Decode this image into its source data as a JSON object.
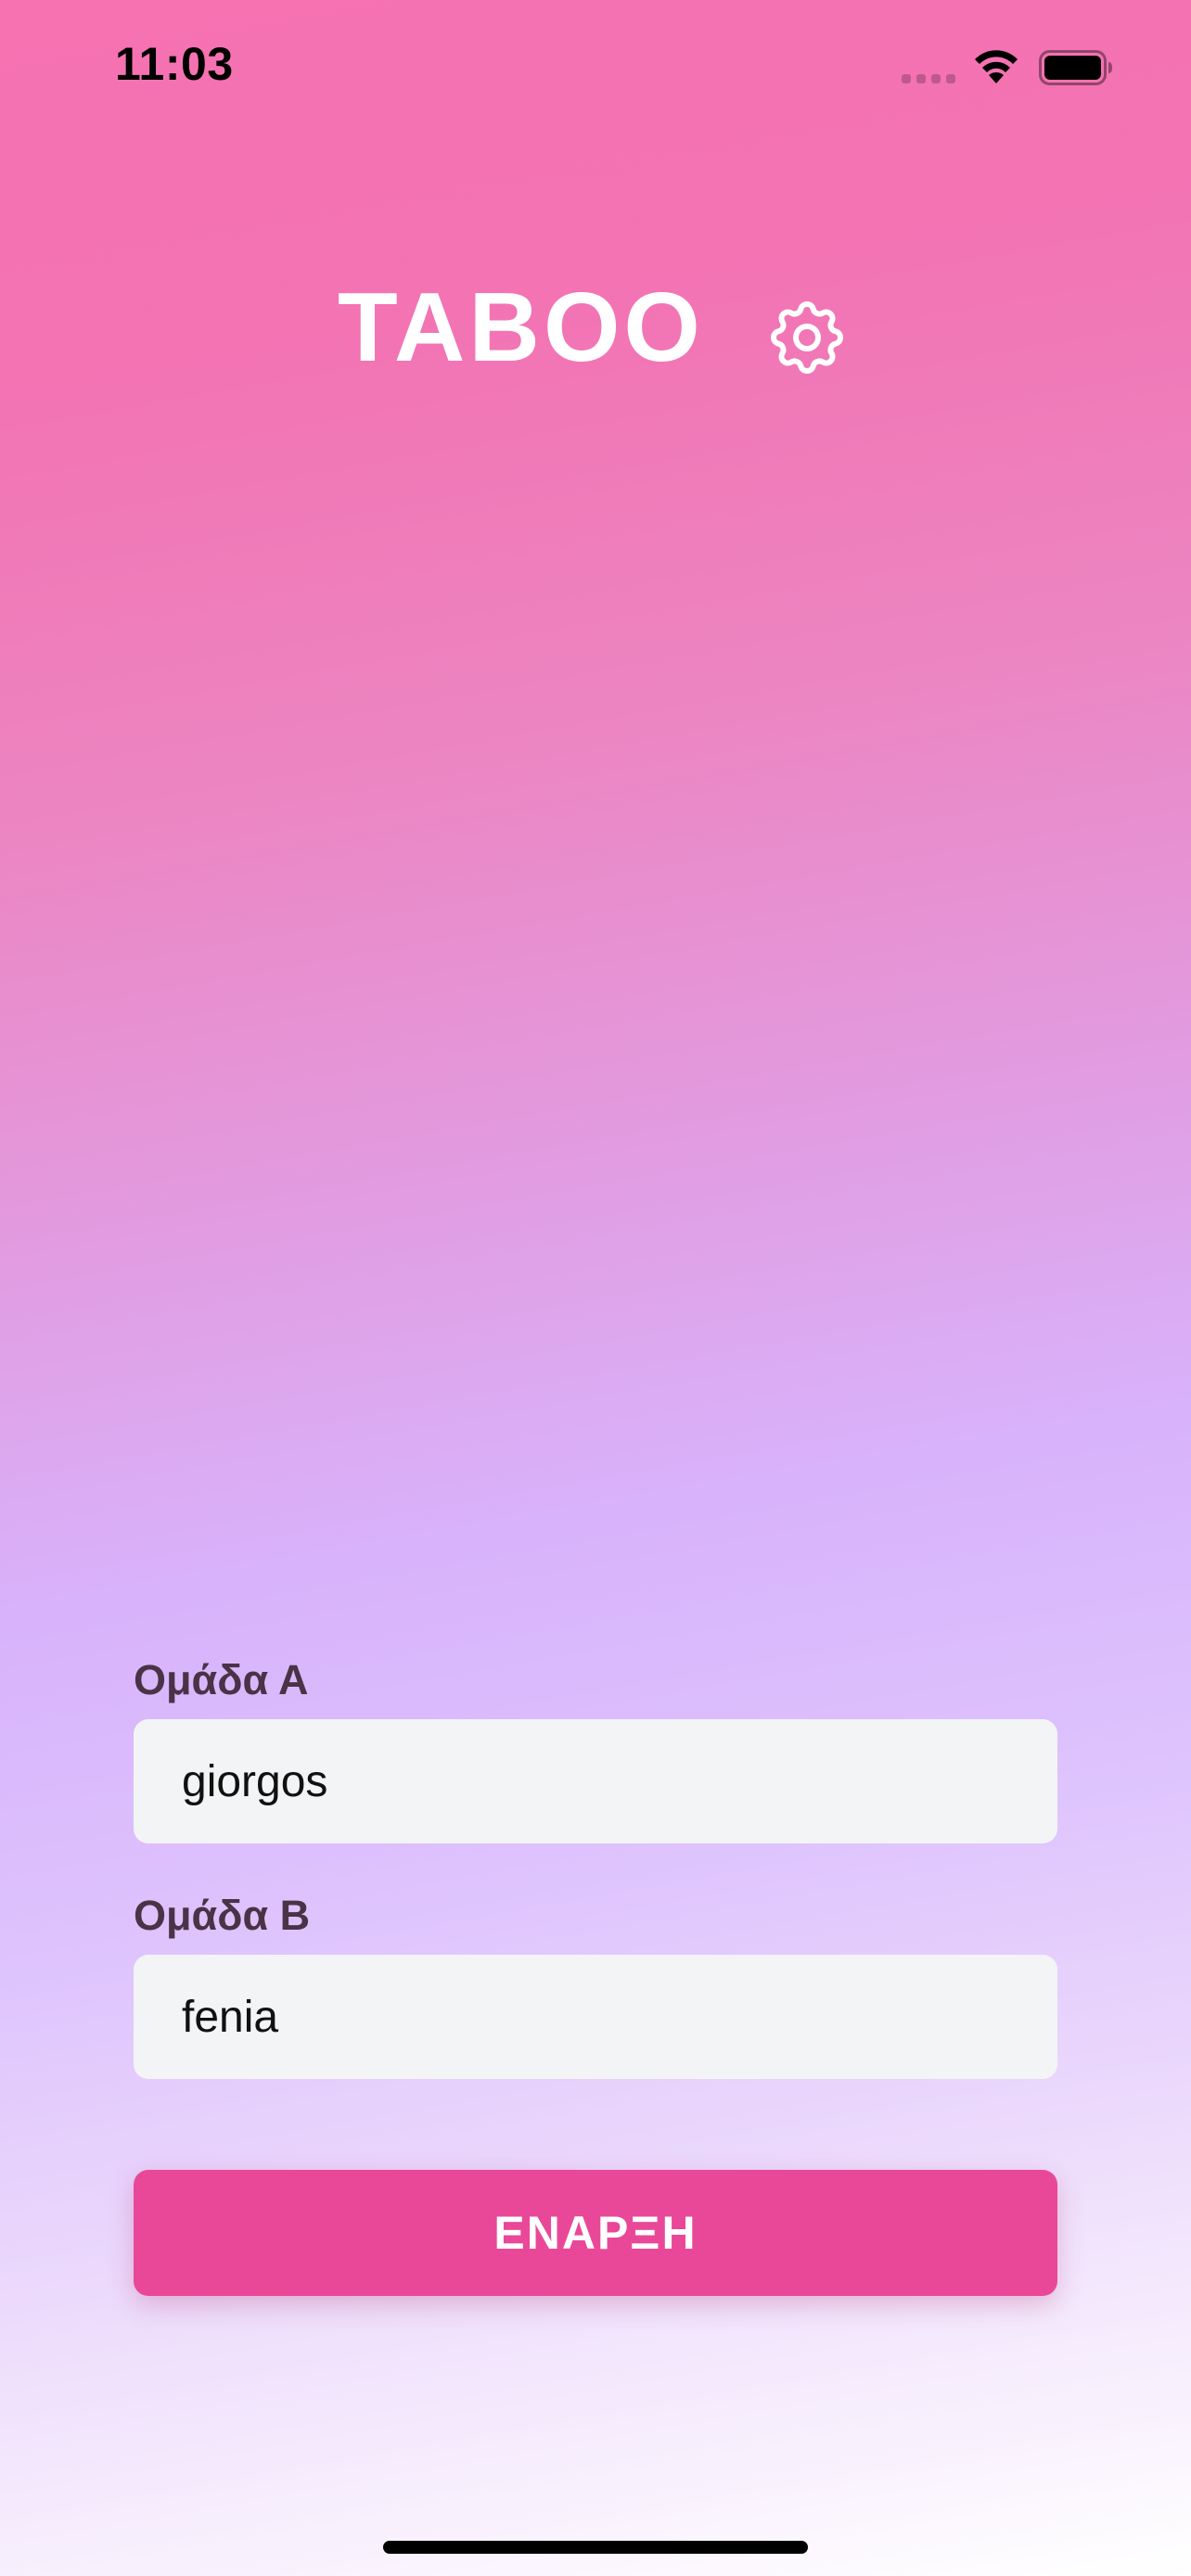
{
  "status_bar": {
    "time": "11:03",
    "icons": [
      "cellular-signal-icon",
      "wifi-icon",
      "battery-icon"
    ]
  },
  "header": {
    "title": "TABOO",
    "settings_icon": "gear-icon"
  },
  "form": {
    "team_a": {
      "label": "Ομάδα Α",
      "value": "giorgos"
    },
    "team_b": {
      "label": "Ομάδα Β",
      "value": "fenia"
    },
    "start_label": "ΕΝΑΡΞΗ"
  },
  "colors": {
    "gradient_top": "#f672b1",
    "gradient_mid": "#d8b2fb",
    "gradient_bottom": "#ffffff",
    "start_button": "#e94898",
    "label_text": "#4a3346",
    "field_bg": "#f3f4f6"
  }
}
